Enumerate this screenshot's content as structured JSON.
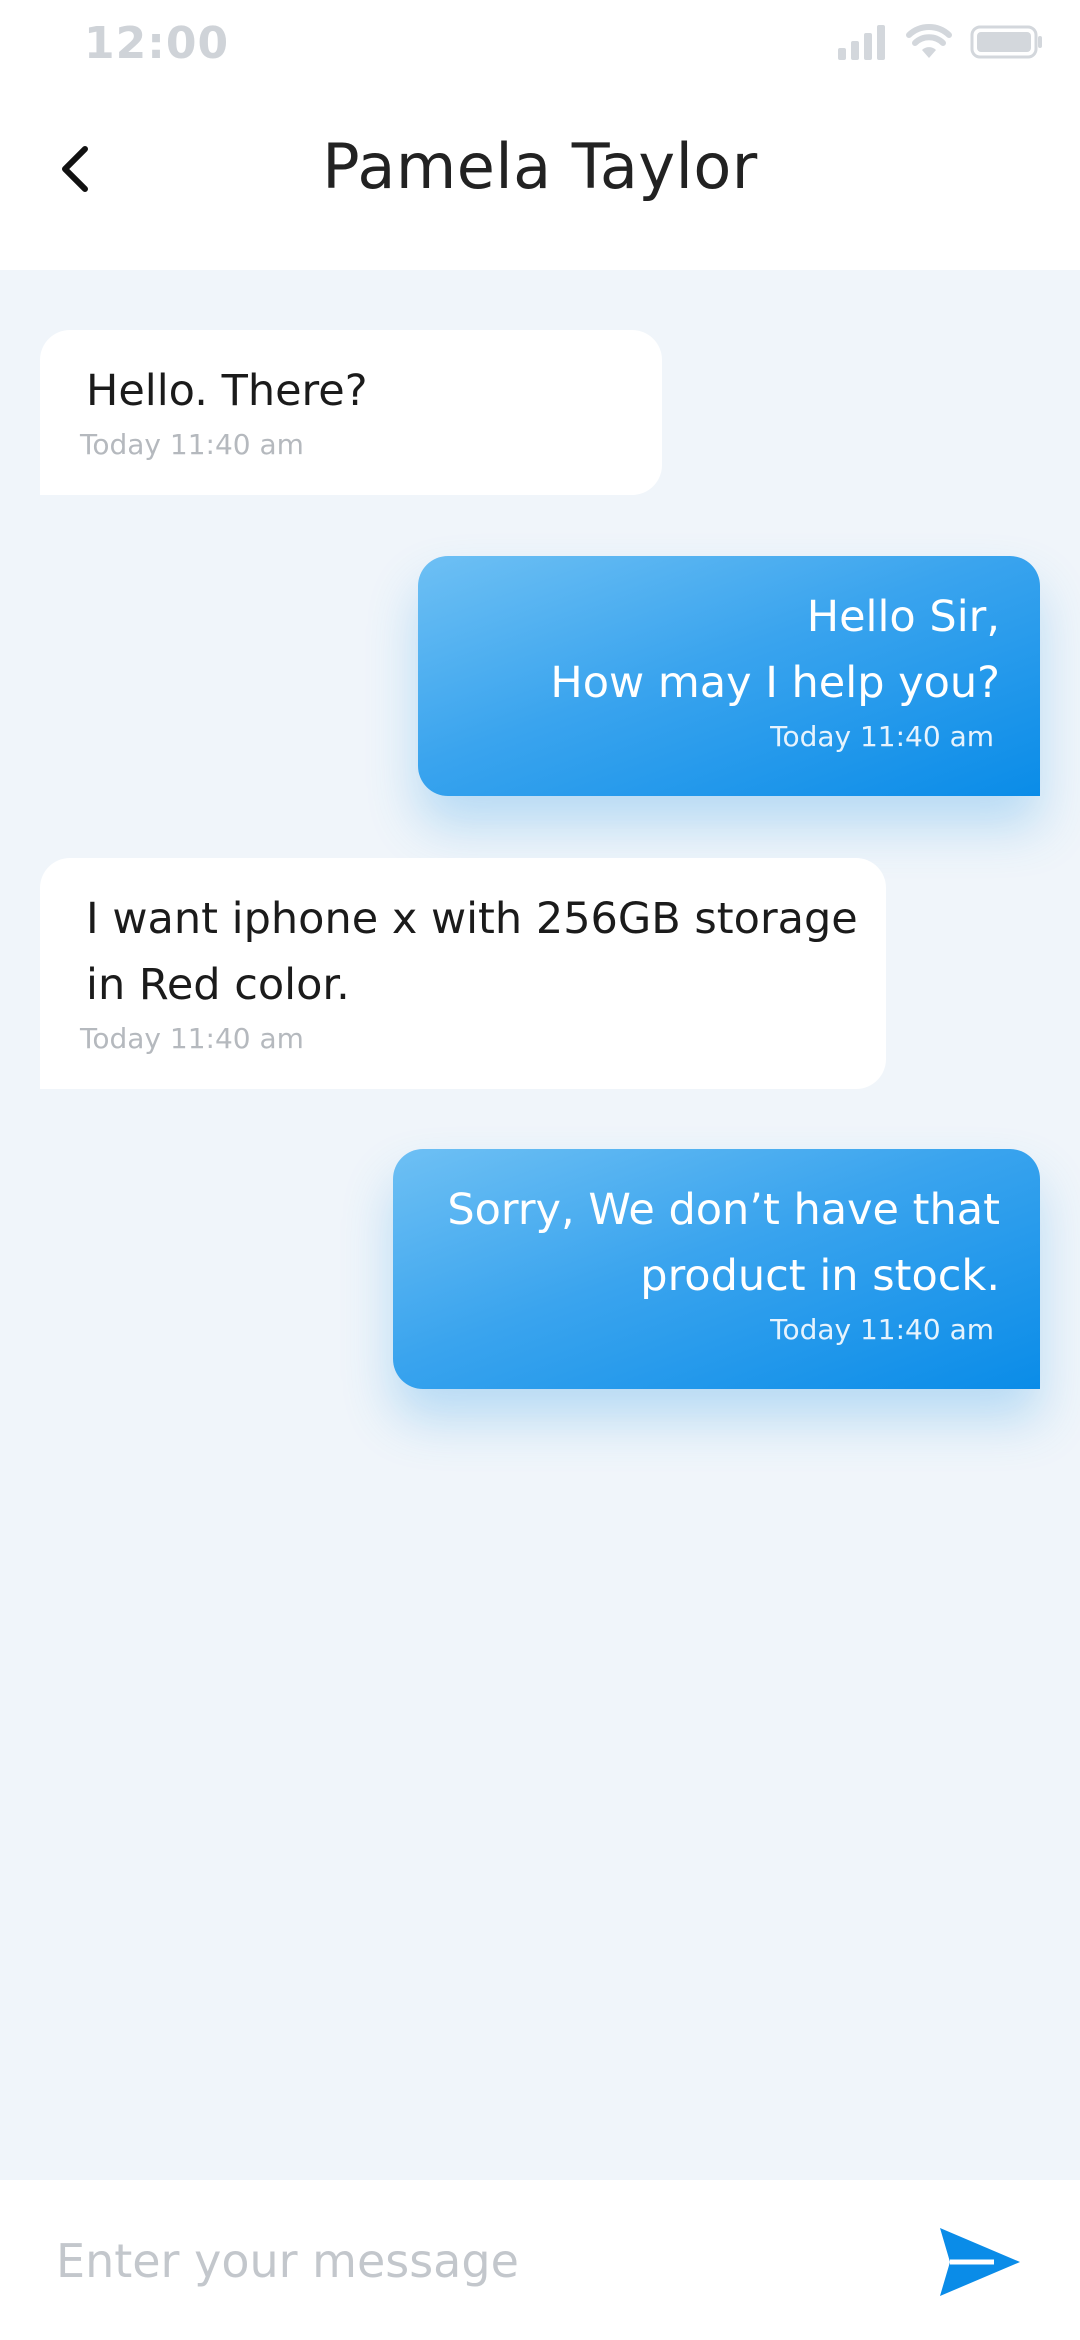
{
  "status_bar": {
    "time": "12:00",
    "icons": [
      "signal-icon",
      "wifi-icon",
      "battery-icon"
    ]
  },
  "header": {
    "title": "Pamela Taylor",
    "back_icon": "chevron-left-icon"
  },
  "messages": [
    {
      "direction": "incoming",
      "text": "Hello. There?",
      "time": "Today  11:40 am"
    },
    {
      "direction": "outgoing",
      "text": "Hello Sir,\nHow may I help you?",
      "time": "Today  11:40 am"
    },
    {
      "direction": "incoming",
      "text": "I want iphone x with 256GB storage\nin Red color.",
      "time": "Today  11:40 am"
    },
    {
      "direction": "outgoing",
      "text": "Sorry, We don’t have that\nproduct in stock.",
      "time": "Today  11:40 am"
    }
  ],
  "composer": {
    "placeholder": "Enter your message",
    "value": "",
    "send_icon": "send-icon"
  },
  "colors": {
    "accent": "#0a8ce8",
    "background": "#f0f5fa",
    "incoming_bubble": "#ffffff"
  }
}
